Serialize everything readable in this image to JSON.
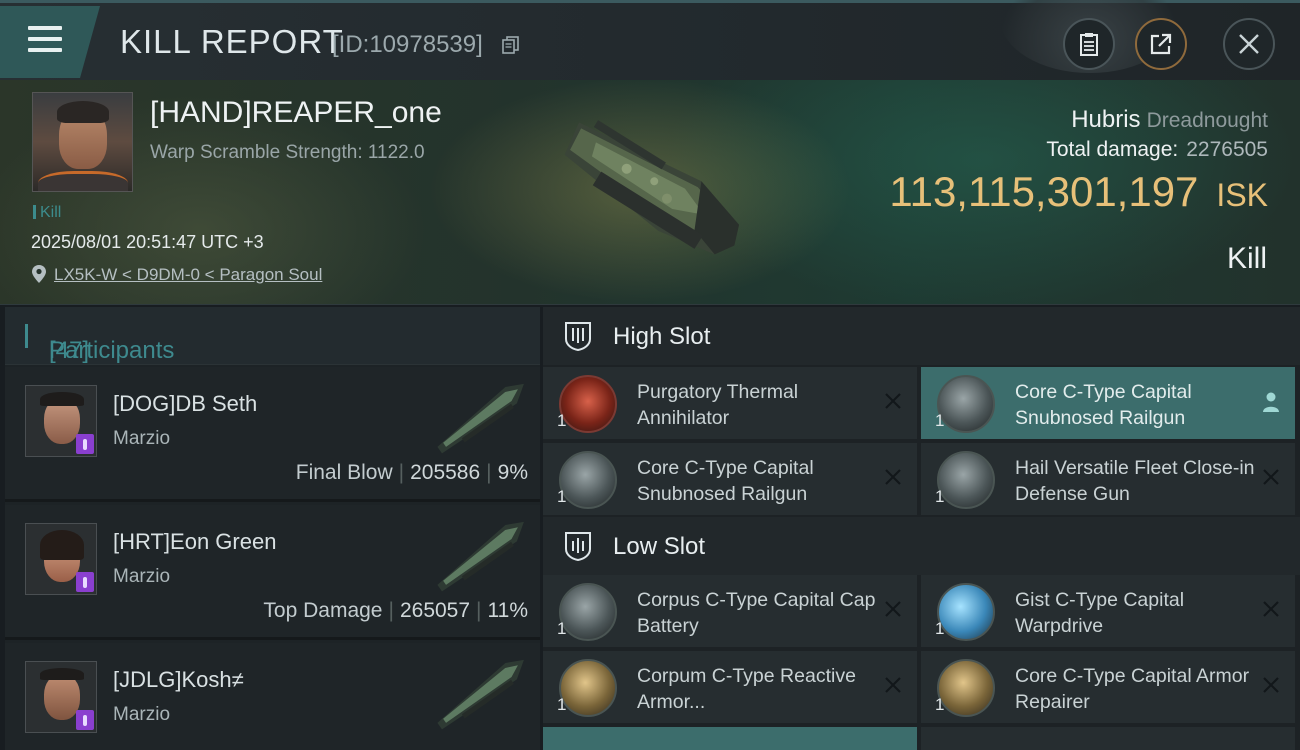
{
  "header": {
    "title": "KILL REPORT",
    "report_id": "[ID:10978539]",
    "icons": [
      "menu-icon",
      "copy-icon",
      "clipboard-icon",
      "share-icon",
      "close-icon"
    ]
  },
  "victim": {
    "name": "[HAND]REAPER_one",
    "warp_scramble": "Warp Scramble Strength: 1122.0",
    "tag": "Kill",
    "datetime": "2025/08/01 20:51:47 UTC +3",
    "location": "LX5K-W < D9DM-0 < Paragon Soul"
  },
  "ship": {
    "name": "Hubris",
    "class": "Dreadnought",
    "total_damage_label": "Total damage:",
    "total_damage": "2276505",
    "value": "113,115,301,197",
    "currency": "ISK",
    "result": "Kill"
  },
  "participants": {
    "header": "Participants",
    "count": "[47]",
    "rows": [
      {
        "name": "[DOG]DB Seth",
        "ship": "Marzio",
        "label": "Final Blow",
        "damage": "205586",
        "percent": "9%"
      },
      {
        "name": "[HRT]Eon Green",
        "ship": "Marzio",
        "label": "Top Damage",
        "damage": "265057",
        "percent": "11%"
      },
      {
        "name": "[JDLG]Kosh≠",
        "ship": "Marzio",
        "label": "",
        "damage": "",
        "percent": ""
      }
    ]
  },
  "fitting": {
    "high_slot_label": "High Slot",
    "low_slot_label": "Low Slot",
    "high": [
      {
        "name": "Purgatory Thermal Annihilator",
        "qty": "1",
        "action_icon": "close-icon"
      },
      {
        "name": "Core C-Type Capital Snubnosed Railgun",
        "qty": "1",
        "action_icon": "person-icon"
      },
      {
        "name": "Core C-Type Capital Snubnosed Railgun",
        "qty": "1",
        "action_icon": "close-icon"
      },
      {
        "name": "Hail Versatile Fleet Close-in Defense Gun",
        "qty": "1",
        "action_icon": "close-icon"
      }
    ],
    "low": [
      {
        "name": "Corpus C-Type Capital Cap Battery",
        "qty": "1",
        "action_icon": "close-icon"
      },
      {
        "name": "Gist C-Type Capital Warpdrive",
        "qty": "1",
        "action_icon": "close-icon"
      },
      {
        "name": "Corpum C-Type Reactive Armor...",
        "qty": "1",
        "action_icon": "close-icon"
      },
      {
        "name": "Core C-Type Capital Armor Repairer",
        "qty": "1",
        "action_icon": "close-icon"
      }
    ]
  },
  "colors": {
    "accent": "#3e8a8e",
    "isk": "#e7c079",
    "selected": "#3c6d6c"
  }
}
